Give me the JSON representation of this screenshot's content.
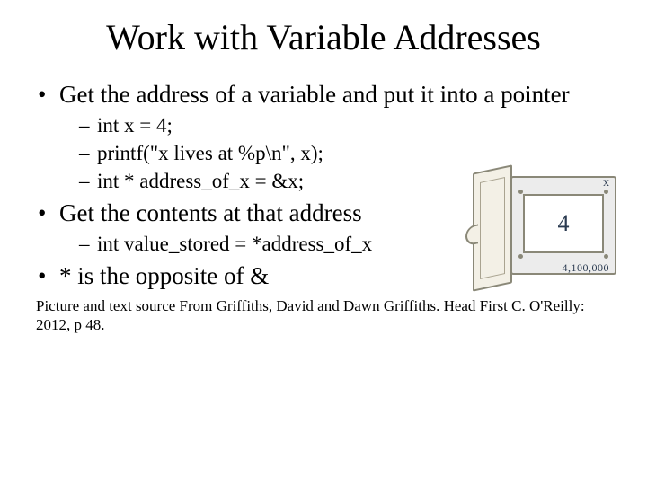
{
  "title": "Work with Variable Addresses",
  "bullets": {
    "b1": "Get the address of a variable and put it into a pointer",
    "s1a": "int x = 4;",
    "s1b": "printf(\"x lives at %p\\n\", x);",
    "s1c": "int * address_of_x = &x;",
    "b2": "Get the contents at that address",
    "s2a": "int value_stored = *address_of_x",
    "b3": "* is the opposite of &"
  },
  "picture": {
    "var_name": "x",
    "value": "4",
    "address": "4,100,000"
  },
  "source": "Picture and text source From Griffiths, David and Dawn Griffiths. Head First C. O'Reilly: 2012, p 48."
}
